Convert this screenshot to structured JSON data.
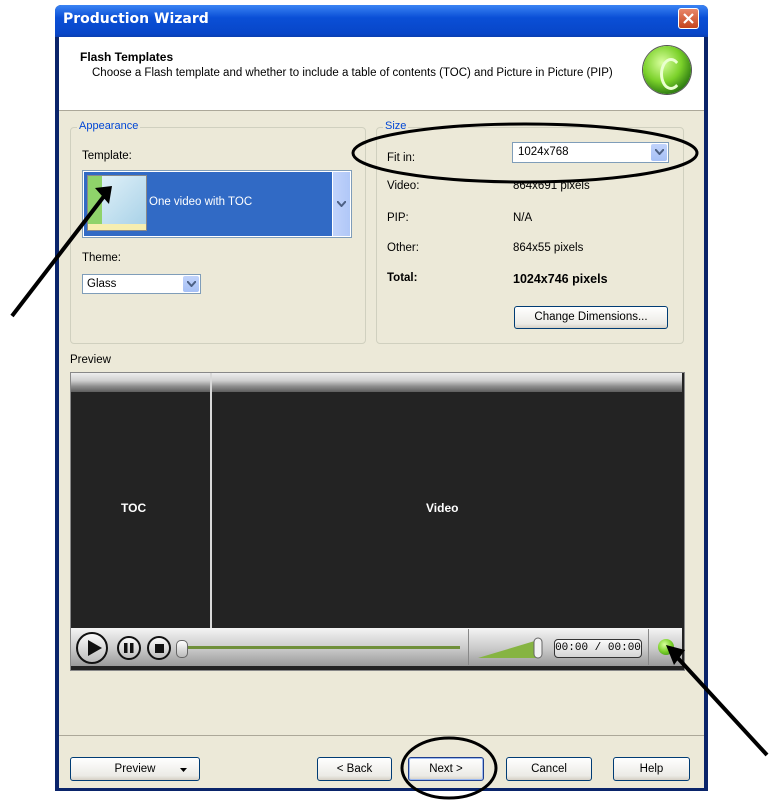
{
  "window": {
    "title": "Production Wizard"
  },
  "header": {
    "title": "Flash Templates",
    "description": "Choose a Flash template and whether to include a table of contents (TOC) and Picture in Picture (PIP)"
  },
  "appearance": {
    "group_label": "Appearance",
    "template_label": "Template:",
    "template_value": "One video with TOC",
    "theme_label": "Theme:",
    "theme_value": "Glass"
  },
  "size": {
    "group_label": "Size",
    "fit_in_label": "Fit in:",
    "fit_in_value": "1024x768",
    "video_label": "Video:",
    "video_value": "864x691 pixels",
    "pip_label": "PIP:",
    "pip_value": "N/A",
    "other_label": "Other:",
    "other_value": "864x55 pixels",
    "total_label": "Total:",
    "total_value": "1024x746 pixels",
    "change_dimensions_label": "Change Dimensions..."
  },
  "preview": {
    "section_label": "Preview",
    "toc_label": "TOC",
    "video_label": "Video",
    "time_display": "00:00 / 00:00"
  },
  "footer": {
    "preview_button": "Preview",
    "back_button": "< Back",
    "next_button": "Next >",
    "cancel_button": "Cancel",
    "help_button": "Help"
  },
  "colors": {
    "title_bar": "#0846c8",
    "selection": "#316ac5",
    "dialog_bg": "#ece9d8",
    "group_label": "#0046d5"
  }
}
